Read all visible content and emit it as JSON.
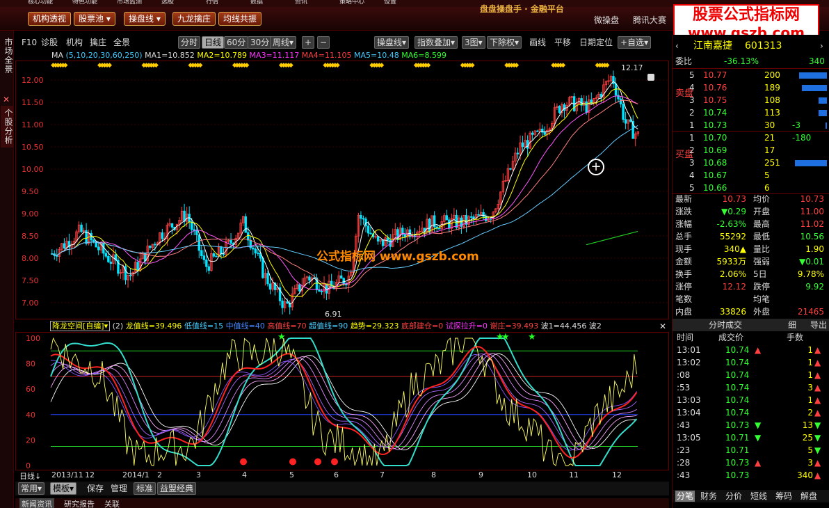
{
  "topbar": {
    "items": [
      "核心功能",
      "特色功能",
      "市场监测",
      "选股",
      "行情",
      "数据",
      "资讯",
      "策略中心",
      "设置"
    ]
  },
  "toolbar": {
    "buttons": [
      "机构透视",
      "股票池",
      "操盘线",
      "九龙擒庄",
      "均线共振"
    ],
    "right": [
      "微操盘",
      "腾讯大赛"
    ],
    "brand": "盘盘操盘手 · 金融平台"
  },
  "watermark": {
    "line1": "股票公式指标网",
    "line2": "www.gszb.com"
  },
  "sidebar": {
    "tab1": "市场全景",
    "tab2": "个股分析",
    "close": "✕"
  },
  "subbar": {
    "items": [
      "F10",
      "诊股",
      "机构",
      "擒庄",
      "全景"
    ],
    "periods": [
      "分时",
      "日线",
      "60分",
      "30分",
      "周线"
    ],
    "tools": [
      "操盘线",
      "指数叠加",
      "3图",
      "下除权",
      "画线",
      "平移",
      "日期定位",
      "+自选"
    ]
  },
  "ma": {
    "label": "MA",
    "params": "(5,10,20,30,60,250)",
    "ma1": "MA1=10.852",
    "ma2": "MA2=10.789",
    "ma3": "MA3=11.117",
    "ma4": "MA4=11.105",
    "ma5": "MA5=10.48",
    "ma6": "MA6=8.599"
  },
  "chart_overlay": {
    "high": "12.17",
    "low": "6.91",
    "text": "公式指标网 www.gszb.com"
  },
  "ind": {
    "name": "降龙空间[自编]",
    "n": "(2)",
    "v1": "龙值线=39.496",
    "v2": "低值线=15",
    "v3": "中值线=40",
    "v4": "高值线=70",
    "v5": "超值线=90",
    "v6": "趋势=29.323",
    "v7": "底部建仓=0",
    "v8": "试探拉升=0",
    "v9": "谢庄=39.493",
    "v10": "波1=44.456",
    "v11": "波2"
  },
  "xaxis": {
    "period": "日线",
    "labels": [
      "2013/11",
      "12",
      "2014/1",
      "2",
      "3",
      "4",
      "5",
      "6",
      "7",
      "8",
      "9",
      "10",
      "11",
      "12"
    ]
  },
  "bottom": {
    "items": [
      "常用",
      "模板",
      "保存",
      "管理",
      "标准",
      "益盟经典"
    ],
    "tabs": [
      "新闻资讯",
      "研究报告",
      "关联"
    ]
  },
  "panel": {
    "stock": "江南嘉捷",
    "code": "601313",
    "weibi_label": "委比",
    "weibi": "-36.13%",
    "weicha": "340",
    "sell_label": "卖盘",
    "buy_label": "买盘",
    "sell": [
      [
        "5",
        "10.77",
        "200",
        ""
      ],
      [
        "4",
        "10.76",
        "189",
        ""
      ],
      [
        "3",
        "10.75",
        "108",
        ""
      ],
      [
        "2",
        "10.74",
        "113",
        ""
      ],
      [
        "1",
        "10.73",
        "30",
        "-3"
      ]
    ],
    "buy": [
      [
        "1",
        "10.70",
        "21",
        "-180"
      ],
      [
        "2",
        "10.69",
        "17",
        ""
      ],
      [
        "3",
        "10.68",
        "251",
        ""
      ],
      [
        "4",
        "10.67",
        "5",
        ""
      ],
      [
        "5",
        "10.66",
        "6",
        ""
      ]
    ],
    "stats": [
      [
        "最新",
        "10.73",
        "均价",
        "10.73"
      ],
      [
        "涨跌",
        "▼0.29",
        "开盘",
        "11.00"
      ],
      [
        "涨幅",
        "-2.63%",
        "最高",
        "11.02"
      ],
      [
        "总手",
        "55292",
        "最低",
        "10.56"
      ],
      [
        "现手",
        "340▲",
        "量比",
        "1.90"
      ],
      [
        "金额",
        "5933万",
        "强弱",
        "▼0.01"
      ],
      [
        "换手",
        "2.06%",
        "5日",
        "9.78%"
      ],
      [
        "涨停",
        "12.12",
        "跌停",
        "9.92"
      ],
      [
        "笔数",
        "",
        "均笔",
        ""
      ],
      [
        "内盘",
        "33826",
        "外盘",
        "21465"
      ]
    ],
    "trades_title": "分时成交",
    "trades_btn1": "细",
    "trades_btn2": "导出",
    "trade_head": [
      "时间",
      "成交价",
      "手数"
    ],
    "trades": [
      [
        "13:01",
        "10.74",
        "▲",
        "1",
        "▲"
      ],
      [
        "13:02",
        "10.74",
        "",
        "1",
        "▲"
      ],
      [
        ":08",
        "10.74",
        "",
        "1",
        "▲"
      ],
      [
        ":53",
        "10.74",
        "",
        "3",
        "▲"
      ],
      [
        "13:03",
        "10.74",
        "",
        "1",
        "▲"
      ],
      [
        "13:04",
        "10.74",
        "",
        "2",
        "▲"
      ],
      [
        ":43",
        "10.73",
        "▼",
        "13",
        "▼"
      ],
      [
        "13:05",
        "10.71",
        "▼",
        "25",
        "▼"
      ],
      [
        ":23",
        "10.71",
        "",
        "5",
        "▼"
      ],
      [
        ":28",
        "10.73",
        "▲",
        "3",
        "▲"
      ],
      [
        ":43",
        "10.73",
        "",
        "340",
        "▲"
      ]
    ],
    "tabs": [
      "分笔",
      "财务",
      "分价",
      "短线",
      "筹码",
      "解盘"
    ]
  },
  "colors": {
    "up": "#ff4040",
    "down": "#00e5ff",
    "ma1": "#ffffff",
    "ma2": "#ffff00",
    "ma3": "#ff55ff",
    "ma4": "#ff8080",
    "ma5": "#66ccff",
    "ma6": "#22cc22"
  }
}
